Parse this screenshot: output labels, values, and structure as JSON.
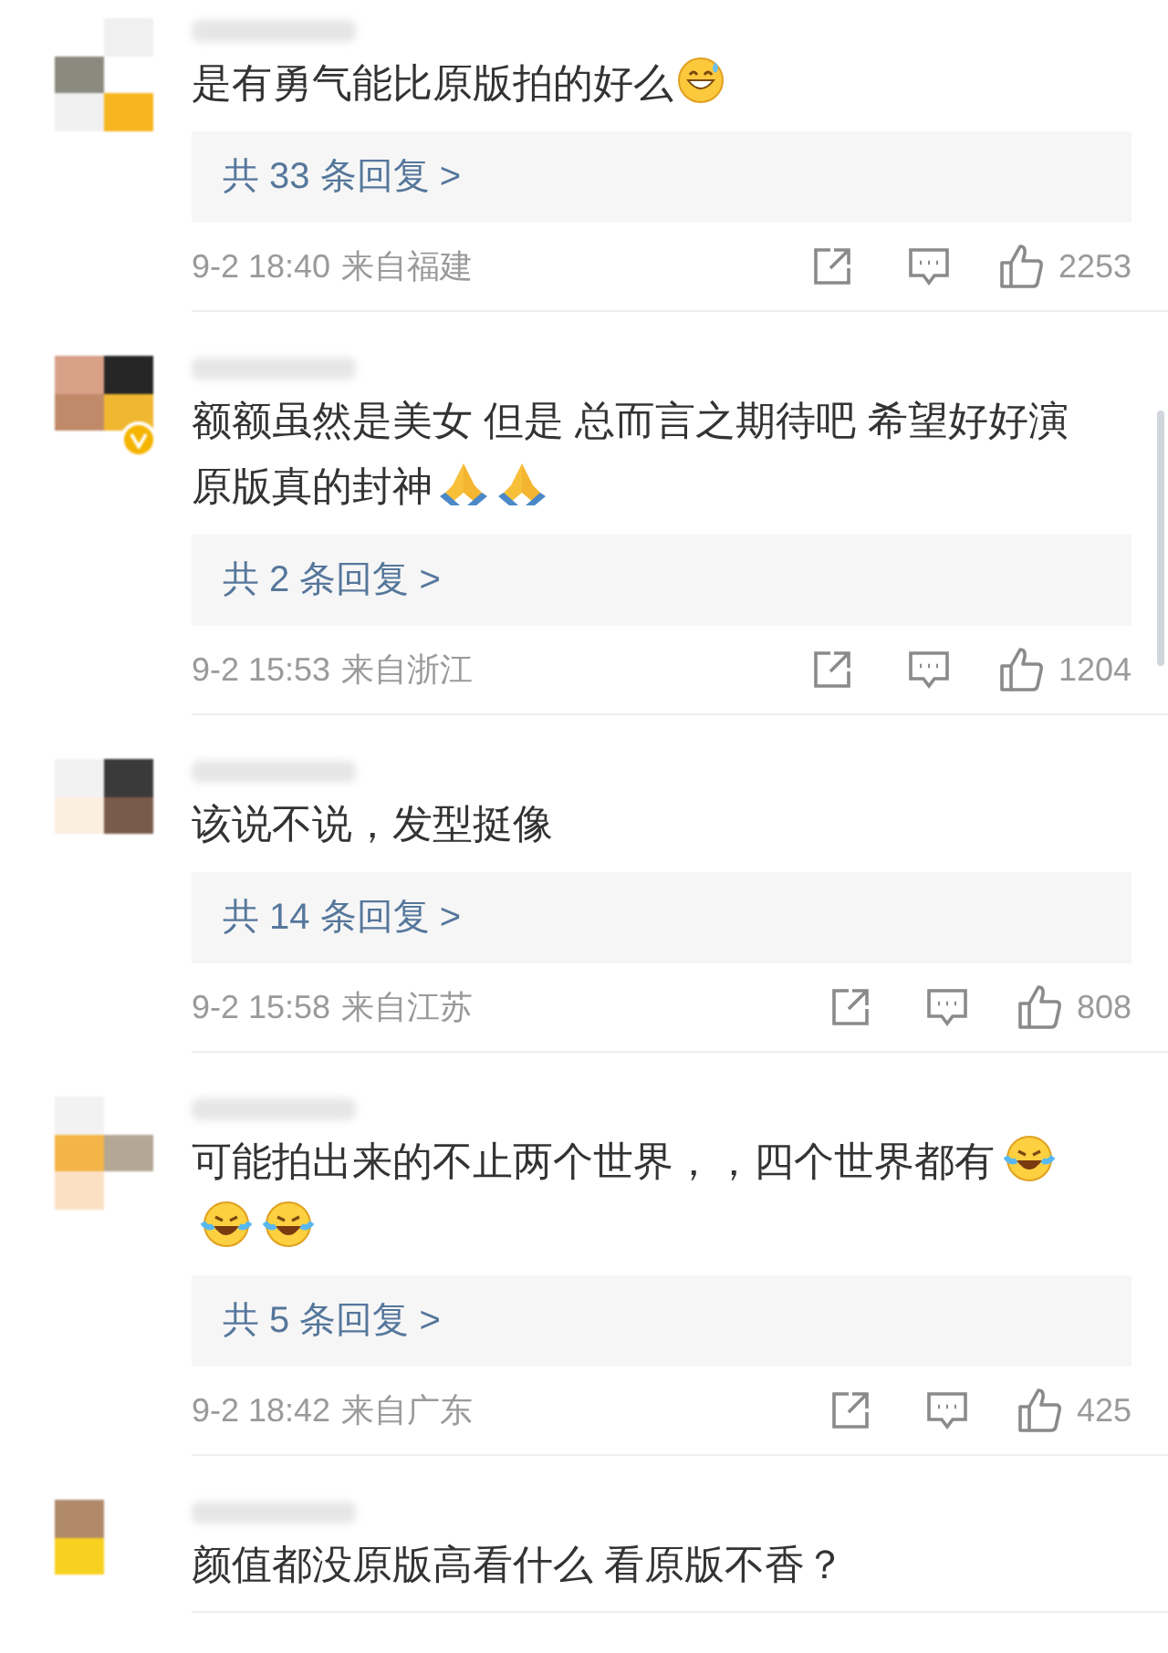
{
  "comments": [
    {
      "verified": false,
      "text": "是有勇气能比原版拍的好么",
      "emojis": [
        {
          "kind": "sweat-smile"
        }
      ],
      "replies": "共 33 条回复 >",
      "date": "9-2 18:40",
      "location": "来自福建",
      "likes": "2253"
    },
    {
      "verified": true,
      "text": "额额虽然是美女 但是 总而言之期待吧 希望好好演原版真的封神",
      "emojis": [
        {
          "kind": "pray"
        },
        {
          "kind": "pray"
        }
      ],
      "replies": "共 2 条回复 >",
      "date": "9-2 15:53",
      "location": "来自浙江",
      "likes": "1204"
    },
    {
      "verified": false,
      "text": "该说不说，发型挺像",
      "replies": "共 14 条回复 >",
      "date": "9-2 15:58",
      "location": "来自江苏",
      "likes": "808"
    },
    {
      "verified": false,
      "text": "可能拍出来的不止两个世界，，四个世界都有",
      "emojis": [
        {
          "kind": "laugh-cry"
        },
        {
          "kind": "laugh-cry"
        },
        {
          "kind": "laugh-cry"
        }
      ],
      "replies": "共 5 条回复 >",
      "date": "9-2 18:42",
      "location": "来自广东",
      "likes": "425"
    },
    {
      "verified": false,
      "text": "颜值都没原版高看什么 看原版不香？"
    }
  ]
}
